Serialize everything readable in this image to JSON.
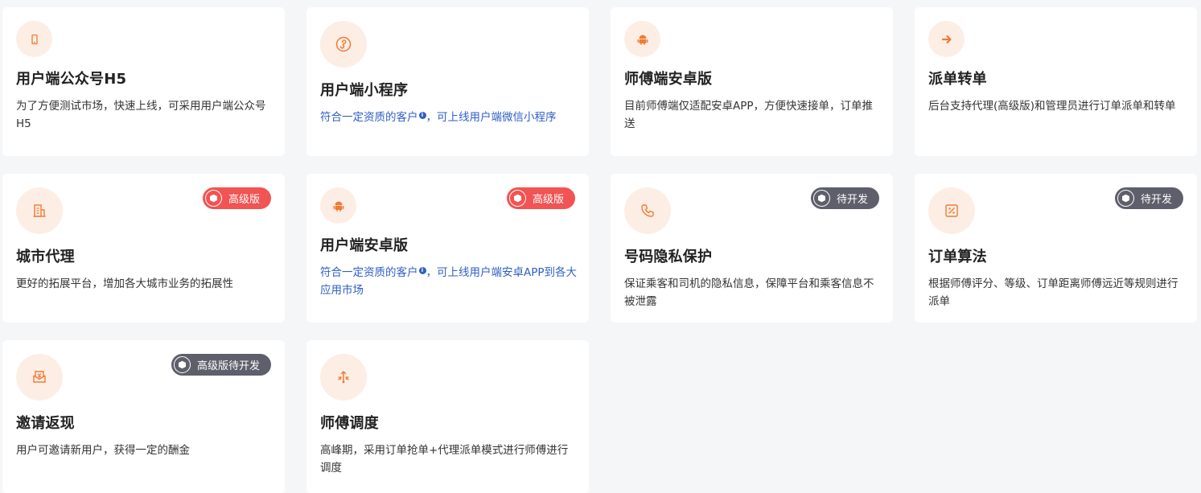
{
  "colors": {
    "accent_orange": "#f07b34",
    "icon_bg": "#fdeee5",
    "badge_red": "#f25353",
    "badge_dark": "#5e5f6b",
    "link_blue": "#2f5fc4"
  },
  "cards": [
    {
      "title": "用户端公众号H5",
      "desc": "为了方便测试市场，快速上线，可采用用户端公众号H5",
      "icon": "mobile-phone-icon"
    },
    {
      "title": "用户端小程序",
      "desc_a": "符合一定资质的客户",
      "desc_b": "，可上线用户端微信小程序",
      "icon": "mini-program-icon"
    },
    {
      "title": "师傅端安卓版",
      "desc": "目前师傅端仅适配安卓APP，方便快速接单，订单推送",
      "icon": "android-icon"
    },
    {
      "title": "派单转单",
      "desc": "后台支持代理(高级版)和管理员进行订单派单和转单",
      "icon": "arrow-right-icon"
    },
    {
      "title": "城市代理",
      "desc": "更好的拓展平台，增加各大城市业务的拓展性",
      "badge": "高级版",
      "icon": "city-building-icon"
    },
    {
      "title": "用户端安卓版",
      "desc_a": "符合一定资质的客户",
      "desc_b": "，可上线用户端安卓APP到各大应用市场",
      "badge": "高级版",
      "icon": "android-icon"
    },
    {
      "title": "号码隐私保护",
      "desc": "保证乘客和司机的隐私信息，保障平台和乘客信息不被泄露",
      "badge": "待开发",
      "icon": "phone-icon"
    },
    {
      "title": "订单算法",
      "desc": "根据师傅评分、等级、订单距离师傅远近等规则进行派单",
      "badge": "待开发",
      "icon": "algorithm-icon"
    },
    {
      "title": "邀请返现",
      "desc": "用户可邀请新用户，获得一定的酬金",
      "badge": "高级版待开发",
      "icon": "cashback-icon"
    },
    {
      "title": "师傅调度",
      "desc": "高峰期，采用订单抢单+代理派单模式进行师傅进行调度",
      "icon": "dispatch-icon"
    }
  ]
}
